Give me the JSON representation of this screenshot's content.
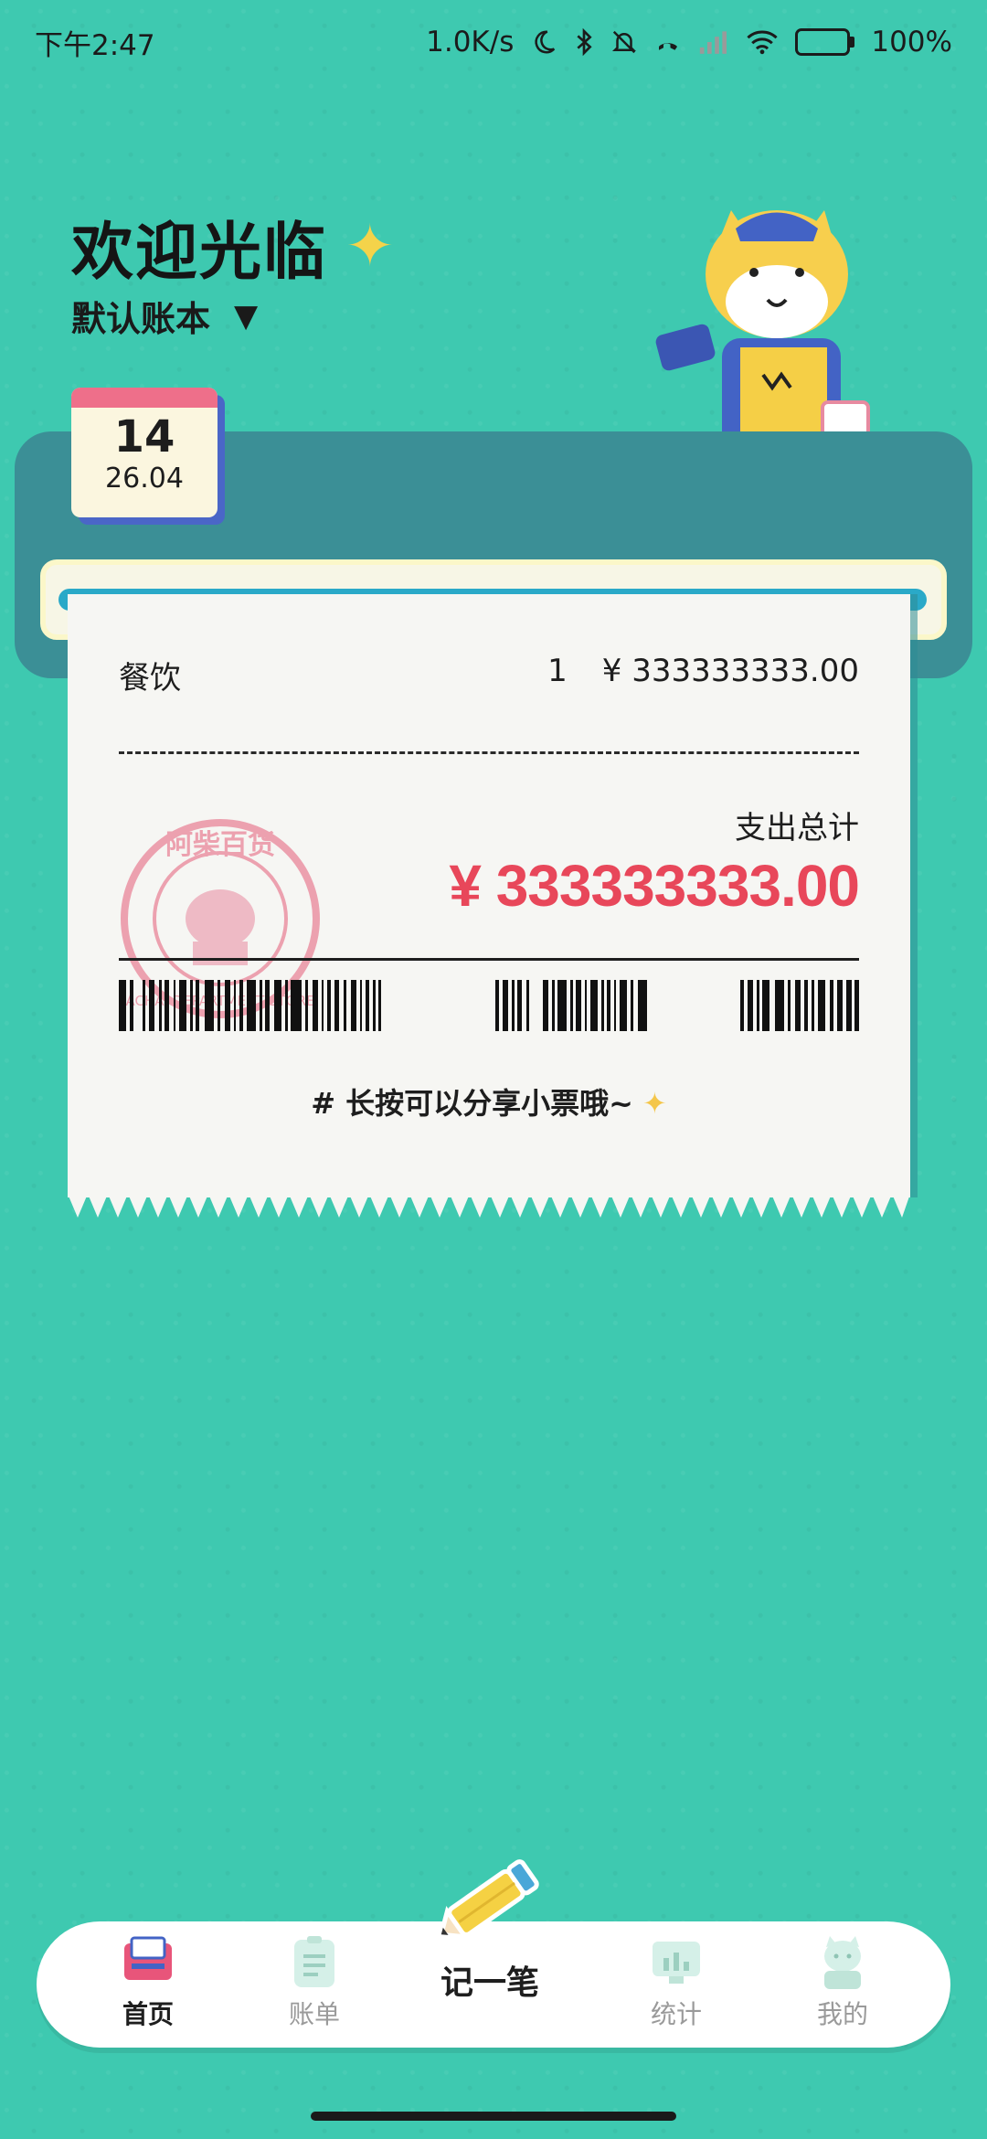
{
  "status_bar": {
    "time": "下午2:47",
    "network_speed": "1.0K/s",
    "battery": "100%",
    "battery_level": 1.0
  },
  "header": {
    "welcome": "欢迎光临",
    "ledger": "默认账本"
  },
  "calendar": {
    "day": "14",
    "date": "26.04"
  },
  "receipt": {
    "item_category": "餐饮",
    "item_count": "1",
    "item_amount": "¥ 333333333.00",
    "total_label": "支出总计",
    "total_amount": "¥ 333333333.00",
    "share_tip": "# 长按可以分享小票哦~",
    "stamp_text": "阿柴百货 ACHAI DEPARTMENT STORE"
  },
  "nav": {
    "home": "首页",
    "bills": "账单",
    "add": "记一笔",
    "stats": "统计",
    "mine": "我的"
  },
  "colors": {
    "background": "#3ec9b0",
    "total_red": "#e8475a",
    "accent_yellow": "#f4d34a"
  },
  "icons": {
    "status": [
      "moon-icon",
      "bluetooth-icon",
      "bell-off-icon",
      "call-icon",
      "signal-icon",
      "wifi-icon",
      "battery-icon"
    ],
    "nav": [
      "home-icon",
      "bills-icon",
      "pencil-icon",
      "stats-icon",
      "profile-icon"
    ]
  }
}
